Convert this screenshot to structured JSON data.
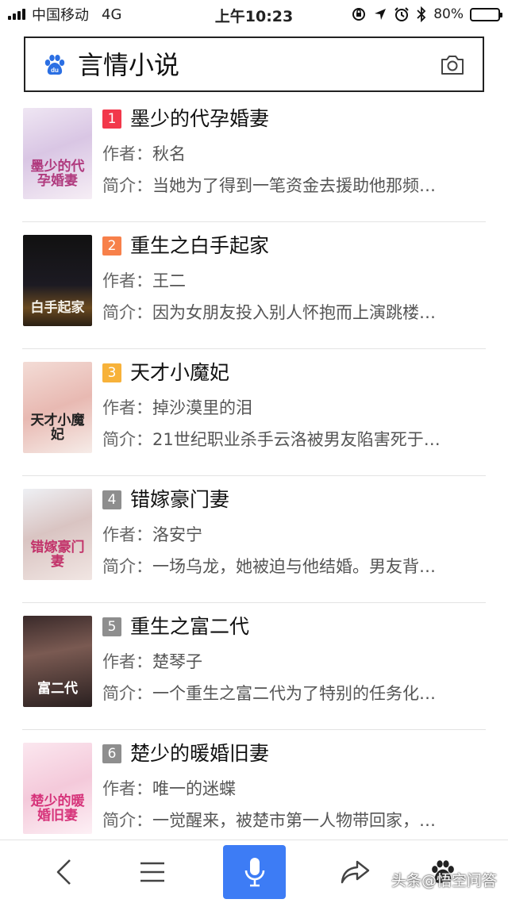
{
  "status_bar": {
    "carrier": "中国移动",
    "network": "4G",
    "time": "上午10:23",
    "battery": "80%",
    "battery_level": 0.8
  },
  "search": {
    "query": "言情小说",
    "logo_icon": "baidu-paw-icon",
    "camera_icon": "camera-icon"
  },
  "books": [
    {
      "rank": "1",
      "rank_color": "#f2384b",
      "title": "墨少的代孕婚妻",
      "author_label": "作者：",
      "author": "秋名",
      "intro_label": "简介：",
      "intro": "当她为了得到一笔资金去援助他那频…",
      "cover_text": "墨少的代孕婚妻"
    },
    {
      "rank": "2",
      "rank_color": "#f7804a",
      "title": "重生之白手起家",
      "author_label": "作者：",
      "author": "王二",
      "intro_label": "简介：",
      "intro": "因为女朋友投入别人怀抱而上演跳楼…",
      "cover_text": "白手起家"
    },
    {
      "rank": "3",
      "rank_color": "#f7b23a",
      "title": "天才小魔妃",
      "author_label": "作者：",
      "author": "掉沙漠里的泪",
      "intro_label": "简介：",
      "intro": "21世纪职业杀手云洛被男友陷害死于…",
      "cover_text": "天才小魔妃"
    },
    {
      "rank": "4",
      "rank_color": "#8e8e8e",
      "title": "错嫁豪门妻",
      "author_label": "作者：",
      "author": "洛安宁",
      "intro_label": "简介：",
      "intro": "一场乌龙，她被迫与他结婚。男友背…",
      "cover_text": "错嫁豪门妻"
    },
    {
      "rank": "5",
      "rank_color": "#8e8e8e",
      "title": "重生之富二代",
      "author_label": "作者：",
      "author": "楚琴子",
      "intro_label": "简介：",
      "intro": "一个重生之富二代为了特别的任务化…",
      "cover_text": "富二代"
    },
    {
      "rank": "6",
      "rank_color": "#8e8e8e",
      "title": "楚少的暖婚旧妻",
      "author_label": "作者：",
      "author": "唯一的迷蝶",
      "intro_label": "简介：",
      "intro": "一觉醒来，被楚市第一人物带回家，…",
      "cover_text": "楚少的暖婚旧妻"
    }
  ],
  "toolbar": {
    "back_icon": "back-chevron-icon",
    "menu_icon": "menu-icon",
    "voice_icon": "microphone-icon",
    "share_icon": "share-arrow-icon",
    "home_icon": "baidu-paw-icon",
    "watermark": "头条@悟空问答",
    "voice_color": "#3d7cf5"
  }
}
